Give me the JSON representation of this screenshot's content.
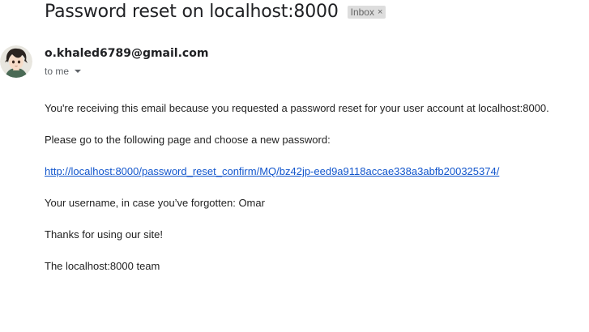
{
  "email": {
    "subject": "Password reset on localhost:8000",
    "label_chip": "Inbox",
    "label_chip_remove": "×",
    "sender": "o.khaled6789@gmail.com",
    "recipient": "to me",
    "body": {
      "intro": "You're receiving this email because you requested a password reset for your user account at localhost:8000.",
      "instruction": "Please go to the following page and choose a new password:",
      "reset_link": "http://localhost:8000/password_reset_confirm/MQ/bz42jp-eed9a9118accae338a3abfb200325374/",
      "username_line": "Your username, in case you’ve forgotten: Omar",
      "thanks": "Thanks for using our site!",
      "signature": "The localhost:8000 team"
    }
  },
  "icons": {
    "avatar": "anime-avatar",
    "recipient_dropdown": "caret-down-icon"
  },
  "colors": {
    "link": "#1155cc",
    "chip_bg": "#dddddd",
    "text": "#222222"
  }
}
